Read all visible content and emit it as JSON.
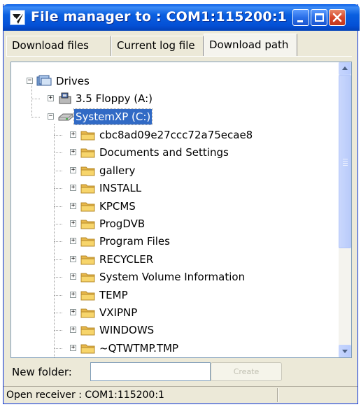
{
  "window": {
    "title": "File manager to : COM1:115200:1"
  },
  "tabs": [
    {
      "label": "Download files",
      "active": false
    },
    {
      "label": "Current log file",
      "active": false
    },
    {
      "label": "Download path",
      "active": true
    }
  ],
  "tree": {
    "root": {
      "label": "Drives",
      "icon": "drives-icon",
      "expanded": true
    },
    "drives": [
      {
        "label": "3.5 Floppy (A:)",
        "icon": "floppy-icon",
        "expanded": false,
        "selected": false
      },
      {
        "label": "SystemXP (C:)",
        "icon": "hard-drive-icon",
        "expanded": true,
        "selected": true
      }
    ],
    "folders": [
      "cbc8ad09e27ccc72a75ecae8",
      "Documents and Settings",
      "gallery",
      "INSTALL",
      "KPCMS",
      "ProgDVB",
      "Program Files",
      "RECYCLER",
      "System Volume Information",
      "TEMP",
      "VXIPNP",
      "WINDOWS",
      "~QTWTMP.TMP"
    ]
  },
  "new_folder": {
    "label": "New folder:",
    "value": "",
    "create_label": "Create"
  },
  "status": {
    "text": "Open receiver : COM1:115200:1"
  },
  "colors": {
    "titlebar": "#0450d6",
    "selection": "#316ac5",
    "folder": "#f7d56b"
  }
}
